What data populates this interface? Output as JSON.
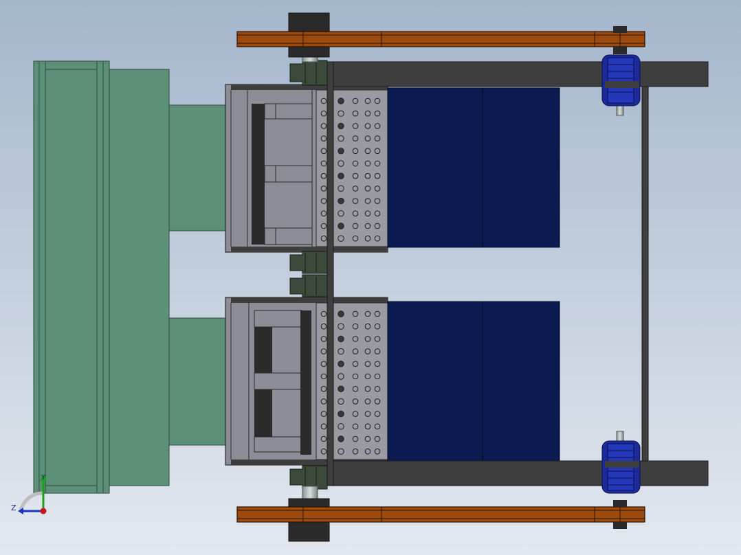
{
  "viewport": {
    "background_top": "#a4b6cc",
    "background_bottom": "#e3e8ef"
  },
  "colors": {
    "hopper_green": "#5c9079",
    "hopper_edge": "#2f4a3e",
    "frame_dark": "#3e3e3e",
    "housing_gray": "#8c8d96",
    "blade_dark": "#2b2b2b",
    "panel_navy": "#0c1a52",
    "belt_orange": "#9c4a0e",
    "motor_blue": "#1c2a9a",
    "coupler_gray": "#3c4a3c"
  },
  "triad": {
    "y_label": "Y",
    "z_label": "Z",
    "x_axis_color": "#c8161a",
    "y_axis_color": "#17a317",
    "z_axis_color": "#1b33c4"
  }
}
